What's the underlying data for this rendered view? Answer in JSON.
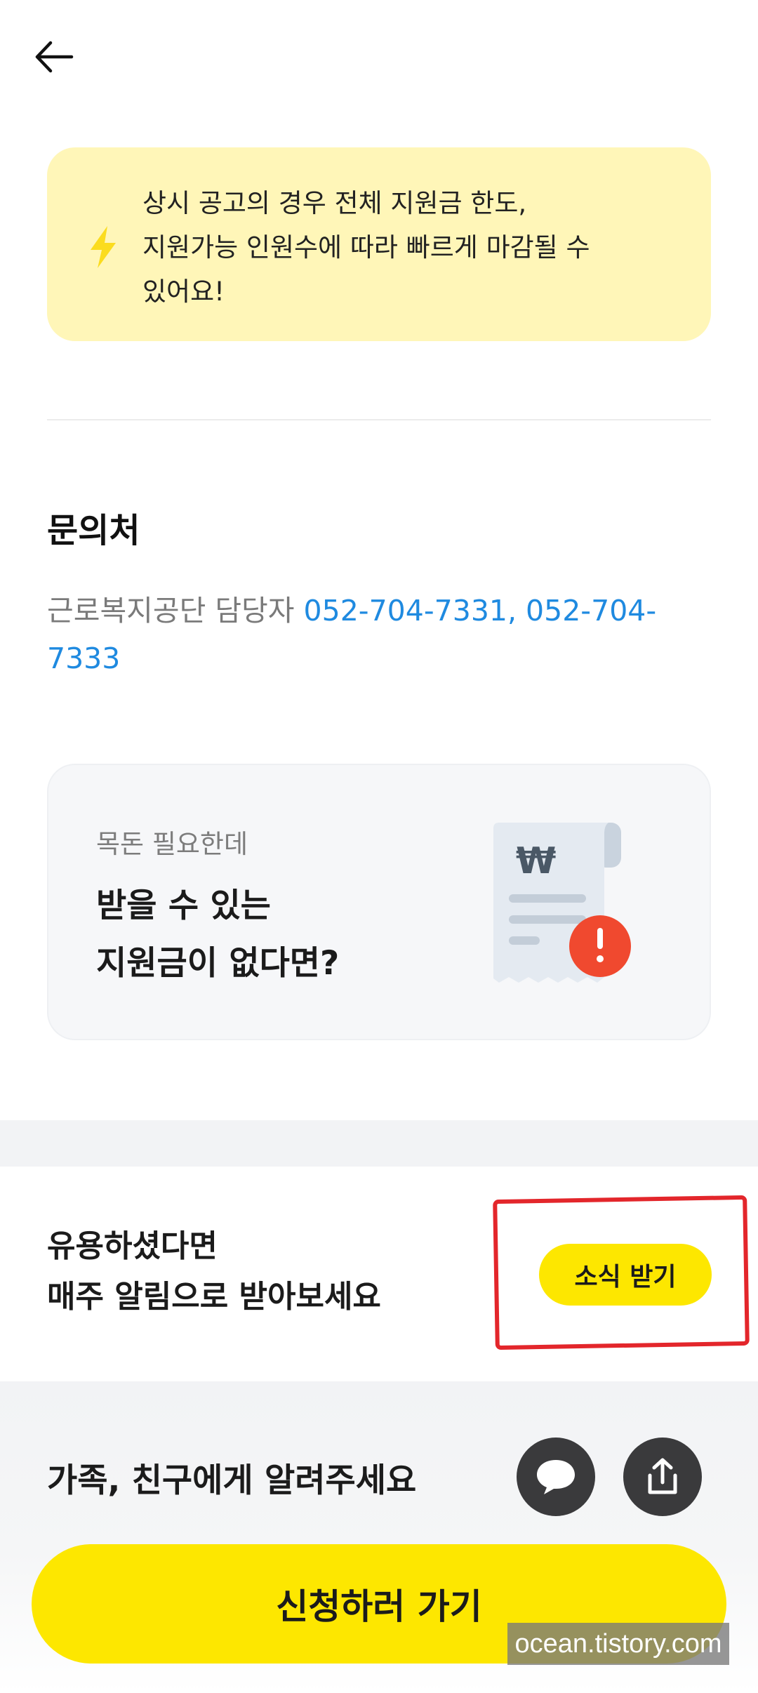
{
  "nav": {
    "back_icon": "arrow-left-icon"
  },
  "notice": {
    "icon": "lightning-icon",
    "lines": [
      "상시 공고의 경우 전체 지원금 한도,",
      "지원가능 인원수에 따라 빠르게 마감될 수",
      "있어요!"
    ]
  },
  "contact": {
    "title": "문의처",
    "prefix": "근로복지공단 담당자 ",
    "phones": "052-704-7331, 052-704-7333"
  },
  "promo": {
    "subtitle": "목돈 필요한데",
    "title_line1": "받을 수 있는",
    "title_line2": "지원금이 없다면?",
    "illustration": "receipt-won-alert-icon"
  },
  "subscribe": {
    "line1": "유용하셨다면",
    "line2": "매주 알림으로 받아보세요",
    "button_label": "소식 받기"
  },
  "share": {
    "label": "가족, 친구에게 알려주세요",
    "kakao_icon": "speech-bubble-icon",
    "share_icon": "share-upload-icon"
  },
  "cta": {
    "label": "신청하러 가기"
  },
  "watermark": {
    "text": "ocean.tistory.com"
  },
  "colors": {
    "accent_yellow": "#fde700",
    "notice_bg": "#fff6b8",
    "link_blue": "#1f8ae0",
    "annotation_red": "#e3262b"
  }
}
